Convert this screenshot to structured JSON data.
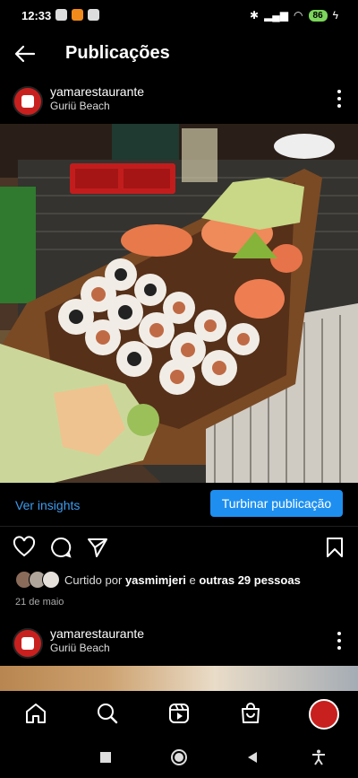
{
  "status_bar": {
    "time": "12:33",
    "battery": "86"
  },
  "header": {
    "title": "Publicações"
  },
  "post": {
    "username": "yamarestaurante",
    "location": "Guriü Beach",
    "date": "21 de maio"
  },
  "insights": {
    "ver_label": "Ver insights",
    "boost_label": "Turbinar publicação"
  },
  "likes": {
    "prefix": "Curtido por",
    "user": "yasmimjeri",
    "conj": "e",
    "others": "outras 29 pessoas"
  },
  "next_post": {
    "username": "yamarestaurante",
    "location": "Guriü Beach"
  },
  "colors": {
    "accent": "#1e8ff0",
    "link": "#3c9cf0",
    "brand_red": "#c8201e"
  },
  "icons": [
    "back-arrow-icon",
    "more-vertical-icon",
    "heart-icon",
    "comment-icon",
    "share-icon",
    "bookmark-icon",
    "home-icon",
    "search-icon",
    "reels-icon",
    "shop-icon",
    "profile-avatar"
  ]
}
